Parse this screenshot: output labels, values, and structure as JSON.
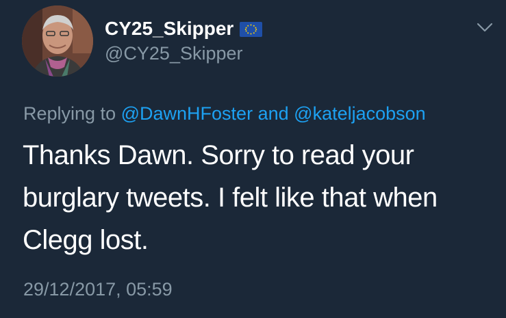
{
  "tweet": {
    "author": {
      "display_name": "CY25_Skipper",
      "handle": "@CY25_Skipper",
      "flag_icon": "eu-flag-icon",
      "avatar_icon": "profile-photo"
    },
    "menu_icon": "chevron-down-icon",
    "reply": {
      "prefix": "Replying to",
      "mention_1": "@DawnHFoster",
      "conjunction": "and",
      "mention_2": "@kateljacobson"
    },
    "text": "Thanks Dawn. Sorry to read your burglary tweets. I felt like that when Clegg lost.",
    "timestamp": "29/12/2017, 05:59"
  },
  "colors": {
    "background": "#1b2838",
    "secondary_text": "#8899a6",
    "link": "#1da1f2",
    "primary_text": "#ffffff"
  }
}
